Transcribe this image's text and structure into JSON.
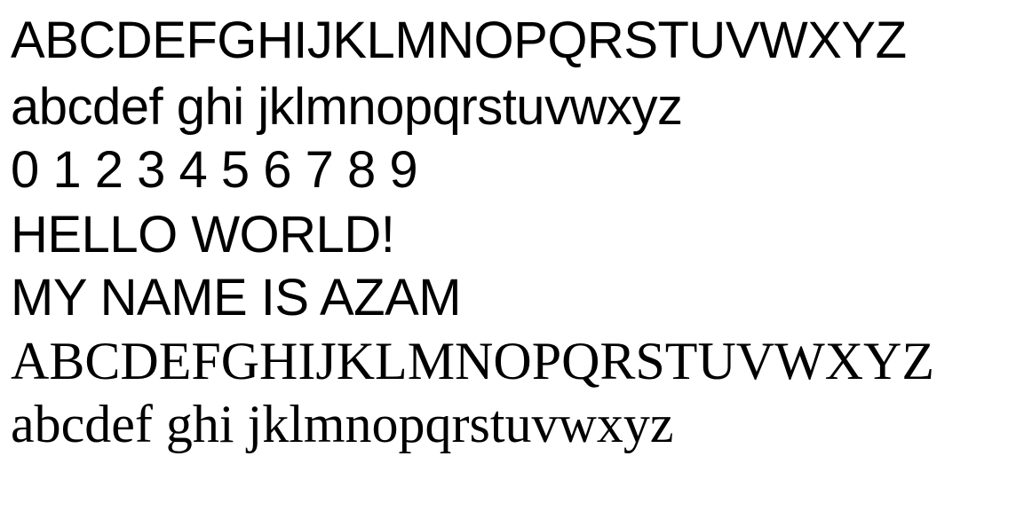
{
  "lines": {
    "uppercase_sans": "ABCDEFGHIJKLMNOPQRSTUVWXYZ",
    "lowercase_sans": "abcdef ghi jklmnopqrstuvwxyz",
    "digits_sans": "0 1 2 3 4 5 6 7 8 9",
    "hello": "HELLO WORLD!",
    "name": "MY NAME IS AZAM",
    "uppercase_serif": "ABCDEFGHIJKLMNOPQRSTUVWXYZ",
    "lowercase_serif": "abcdef ghi jklmnopqrstuvwxyz"
  },
  "colors": {
    "background": "#ffffff",
    "text": "#000000"
  }
}
